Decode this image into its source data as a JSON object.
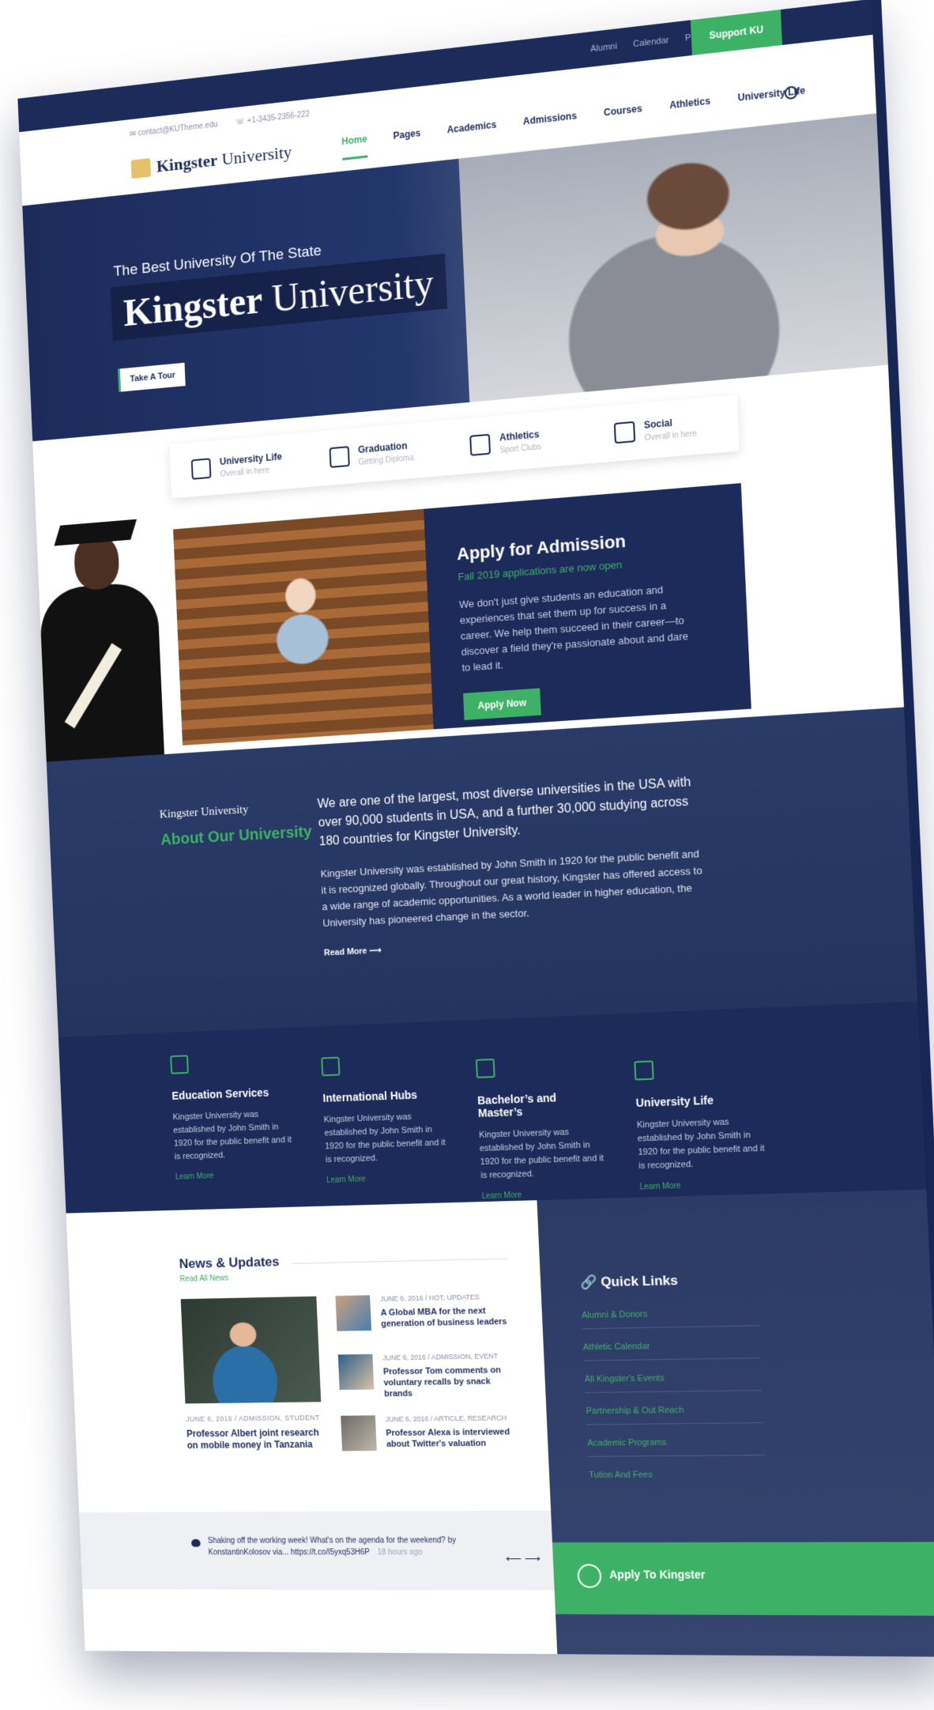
{
  "topbar": {
    "links": [
      "Alumni",
      "Calendar",
      "Portal"
    ],
    "support_label": "Support KU"
  },
  "header": {
    "email": "contact@KUTheme.edu",
    "phone": "+1-3435-2356-222",
    "logo_bold": "Kingster",
    "logo_rest": " University",
    "nav": [
      "Home",
      "Pages",
      "Academics",
      "Admissions",
      "Courses",
      "Athletics",
      "University Life"
    ]
  },
  "hero": {
    "subtitle": "The Best University Of The State",
    "title_bold": "Kingster",
    "title_rest": " University",
    "tour_label": "Take A Tour"
  },
  "tabs": [
    {
      "label": "University Life",
      "sub": "Overall in here",
      "icon": "building-icon"
    },
    {
      "label": "Graduation",
      "sub": "Getting Diploma",
      "icon": "graduation-cap-icon"
    },
    {
      "label": "Athletics",
      "sub": "Sport Clubs",
      "icon": "stadium-icon"
    },
    {
      "label": "Social",
      "sub": "Overall in here",
      "icon": "network-icon"
    }
  ],
  "admission": {
    "title": "Apply for Admission",
    "subtitle": "Fall 2019 applications are now open",
    "text": "We don't just give students an education and experiences that set them up for success in a career. We help them succeed in their career—to discover a field they're passionate about and dare to lead it.",
    "button": "Apply Now"
  },
  "about": {
    "logo": "Kingster University",
    "heading": "About Our University",
    "lead": "We are one of the largest, most diverse universities in the USA with over 90,000 students in USA, and a further 30,000 studying across 180 countries for Kingster University.",
    "text": "Kingster University was established by John Smith in 1920 for the public benefit and it is recognized globally. Throughout our great history, Kingster has offered access to a wide range of academic opportunities. As a world leader in higher education, the University has pioneered change in the sector.",
    "read_more": "Read More ⟶"
  },
  "services": [
    {
      "title": "Education Services",
      "text": "Kingster University was established by John Smith in 1920 for the public benefit and it is recognized.",
      "link": "Learn More"
    },
    {
      "title": "International Hubs",
      "text": "Kingster University was established by John Smith in 1920 for the public benefit and it is recognized.",
      "link": "Learn More"
    },
    {
      "title": "Bachelor’s and Master’s",
      "text": "Kingster University was established by John Smith in 1920 for the public benefit and it is recognized.",
      "link": "Learn More"
    },
    {
      "title": "University Life",
      "text": "Kingster University was established by John Smith in 1920 for the public benefit and it is recognized.",
      "link": "Learn More"
    }
  ],
  "news": {
    "heading": "News & Updates",
    "read_all": "Read All News",
    "main": {
      "meta": "JUNE 6, 2016  /  ADMISSION, STUDENT",
      "title": "Professor Albert joint research on mobile money in Tanzania"
    },
    "items": [
      {
        "meta": "JUNE 6, 2016  /  HOT, UPDATES",
        "title": "A Global MBA for the next generation of business leaders"
      },
      {
        "meta": "JUNE 6, 2016  /  ADMISSION, EVENT",
        "title": "Professor Tom comments on voluntary recalls by snack brands"
      },
      {
        "meta": "JUNE 6, 2016  /  ARTICLE, RESEARCH",
        "title": "Professor Alexa is interviewed about Twitter's valuation"
      }
    ]
  },
  "tweet": {
    "text": "Shaking off the working week! What's on the agenda for the weekend? by KonstantinKolosov via... https://t.co/I5yxq53H6P",
    "time": "18 hours ago",
    "arrows": "⟵ ⟶"
  },
  "quick_links": {
    "heading": "Quick Links",
    "items": [
      "Alumni & Donors",
      "Athletic Calendar",
      "All Kingster's Events",
      "Partnership & Out Reach",
      "Academic Programs",
      "Tution And Fees"
    ]
  },
  "apply_bar": {
    "label": "Apply To Kingster"
  },
  "colors": {
    "navy": "#1c2b5a",
    "green": "#3db166"
  }
}
